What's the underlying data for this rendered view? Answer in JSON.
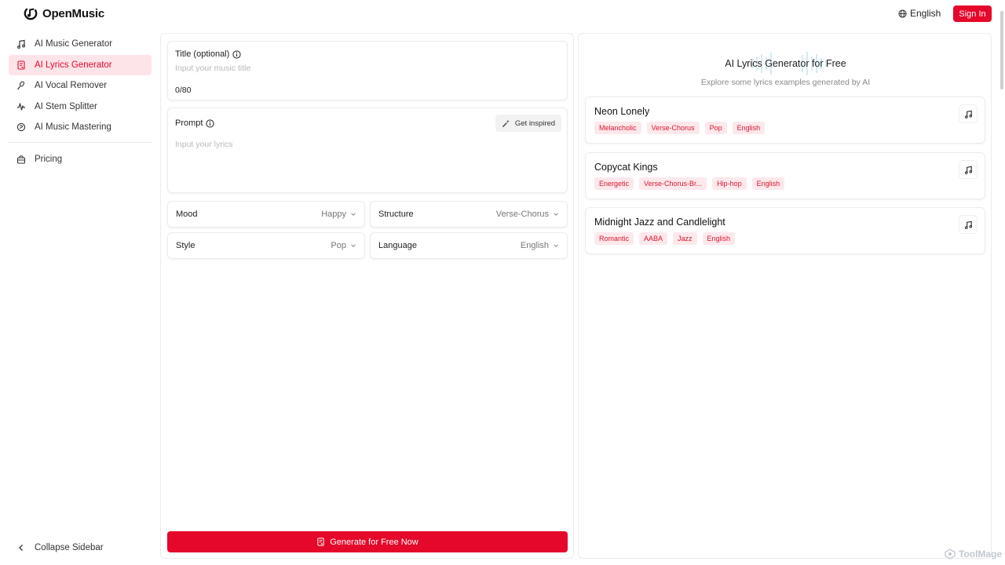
{
  "brand": {
    "name": "OpenMusic"
  },
  "header": {
    "language": "English",
    "sign_in": "Sign In"
  },
  "sidebar": {
    "items": [
      {
        "label": "AI Music Generator",
        "icon": "music-note-icon",
        "active": false
      },
      {
        "label": "AI Lyrics Generator",
        "icon": "lyrics-doc-icon",
        "active": true
      },
      {
        "label": "AI Vocal Remover",
        "icon": "microphone-icon",
        "active": false
      },
      {
        "label": "AI Stem Splitter",
        "icon": "waveform-icon",
        "active": false
      },
      {
        "label": "AI Music Mastering",
        "icon": "mastering-icon",
        "active": false
      }
    ],
    "pricing": "Pricing",
    "collapse": "Collapse Sidebar"
  },
  "form": {
    "title_label": "Title (optional)",
    "title_placeholder": "Input your music title",
    "title_value": "",
    "counter": "0/80",
    "prompt_label": "Prompt",
    "inspire": "Get inspired",
    "prompt_placeholder": "Input your lyrics",
    "prompt_value": "",
    "mood": {
      "label": "Mood",
      "value": "Happy"
    },
    "structure": {
      "label": "Structure",
      "value": "Verse-Chorus"
    },
    "style": {
      "label": "Style",
      "value": "Pop"
    },
    "language": {
      "label": "Language",
      "value": "English"
    },
    "generate": "Generate for Free Now"
  },
  "examples": {
    "title": "AI Lyrics Generator for Free",
    "subtitle": "Explore some lyrics examples generated by AI",
    "items": [
      {
        "title": "Neon Lonely",
        "tags": [
          "Melancholic",
          "Verse-Chorus",
          "Pop",
          "English"
        ]
      },
      {
        "title": "Copycat Kings",
        "tags": [
          "Energetic",
          "Verse-Chorus-Br...",
          "Hip-hop",
          "English"
        ]
      },
      {
        "title": "Midnight Jazz and Candlelight",
        "tags": [
          "Romantic",
          "AABA",
          "Jazz",
          "English"
        ]
      }
    ]
  },
  "watermark": "ToolMage",
  "colors": {
    "accent": "#e5082a",
    "active_bg": "#fde4e8",
    "tag_bg": "#fde8ec",
    "tag_text": "#d9162f"
  }
}
